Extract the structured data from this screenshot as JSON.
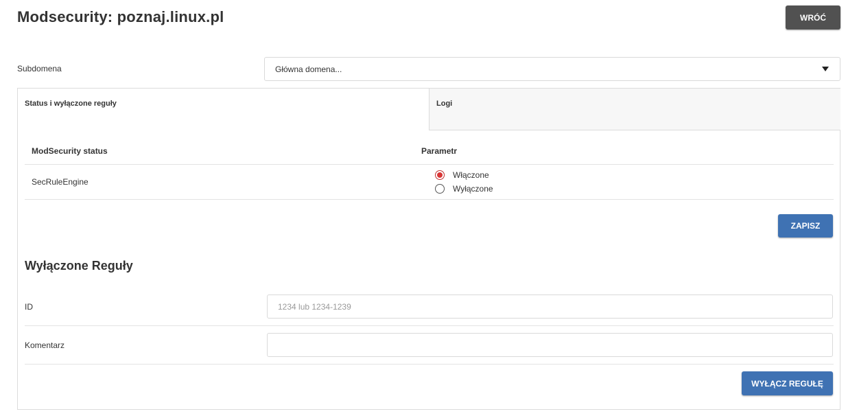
{
  "header": {
    "title": "Modsecurity: poznaj.linux.pl",
    "back_label": "WRÓĆ"
  },
  "subdomain": {
    "label": "Subdomena",
    "selected": "Główna domena..."
  },
  "tabs": [
    {
      "label": "Status i wyłączone reguły",
      "active": true
    },
    {
      "label": "Logi",
      "active": false
    }
  ],
  "status_table": {
    "headers": [
      "ModSecurity status",
      "Parametr"
    ],
    "rows": [
      {
        "name": "SecRuleEngine",
        "options": [
          "Włączone",
          "Wyłączone"
        ],
        "selected": "Włączone"
      }
    ],
    "save_label": "ZAPISZ"
  },
  "disabled_rules": {
    "title": "Wyłączone Reguły",
    "id_label": "ID",
    "id_placeholder": "1234 lub 1234-1239",
    "id_value": "",
    "comment_label": "Komentarz",
    "comment_value": "",
    "submit_label": "WYŁĄCZ REGUŁĘ"
  },
  "colors": {
    "primary": "#3f72b3",
    "back_button": "#515151",
    "radio_checked": "#d93636"
  }
}
